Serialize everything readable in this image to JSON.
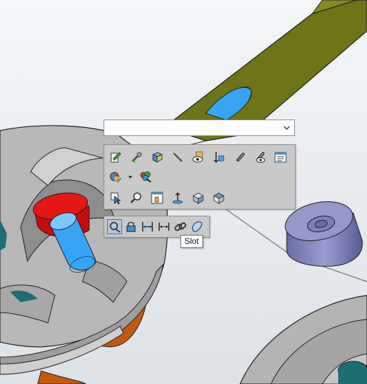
{
  "selection_filter": {
    "value": ""
  },
  "tooltip": {
    "text": "Slot"
  },
  "toolbar": {
    "row1": [
      "sketch-edit-icon",
      "smart-dimension-icon",
      "appearance-icon",
      "line-icon",
      "hide-icon",
      "normal-to-icon",
      "paperclip-icon",
      "hide-show-icon",
      "properties-icon"
    ],
    "row2": [
      "edit-appearance-icon",
      "appearance-dropdown-icon",
      "edit-color-icon"
    ],
    "row3": [
      "select-other-icon",
      "zoom-to-selection-icon",
      "view-orientation-icon",
      "normal-axis-icon",
      "isometric-icon",
      "cube-view-icon"
    ]
  },
  "context_toolbar": [
    "coincident-icon",
    "fix-icon",
    "equal-distance-icon",
    "horizontal-dimension-icon",
    "link-icon",
    "slot-icon"
  ],
  "colors": {
    "olive": "#6f7416",
    "cyan": "#38a4f5",
    "red": "#d51010",
    "orange": "#c25a0d",
    "gray": "#b4b4b4",
    "lavender": "#8587c0",
    "teal": "#1c6e72"
  }
}
